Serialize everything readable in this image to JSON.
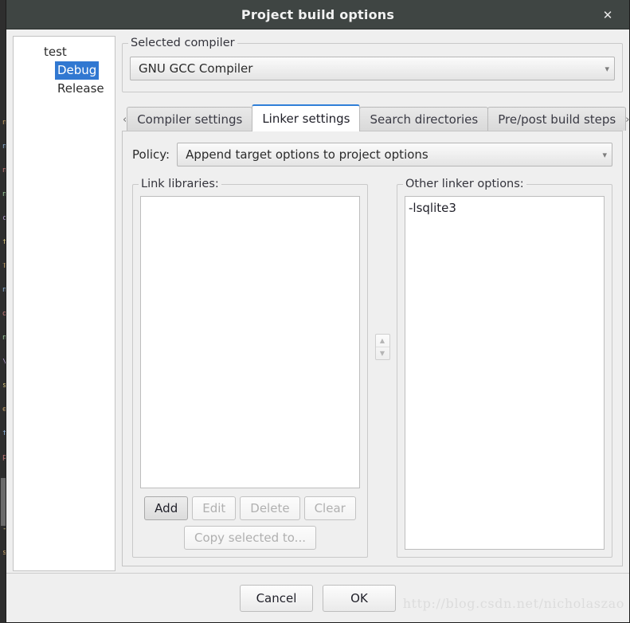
{
  "window": {
    "title": "Project build options",
    "close_label": "✕"
  },
  "tree": {
    "root": "test",
    "children": [
      {
        "label": "Debug",
        "selected": true
      },
      {
        "label": "Release",
        "selected": false
      }
    ]
  },
  "compiler": {
    "group_label": "Selected compiler",
    "selected": "GNU GCC Compiler",
    "arrow": "▾"
  },
  "tabs": {
    "scroll_left": "‹",
    "scroll_right": "›",
    "items": [
      {
        "label": "Compiler settings",
        "active": false
      },
      {
        "label": "Linker settings",
        "active": true
      },
      {
        "label": "Search directories",
        "active": false
      },
      {
        "label": "Pre/post build steps",
        "active": false
      }
    ]
  },
  "policy": {
    "label": "Policy:",
    "value": "Append target options to project options",
    "arrow": "▾"
  },
  "link_libraries": {
    "group_label": "Link libraries:",
    "items": [],
    "buttons": [
      {
        "label": "Add",
        "enabled": true
      },
      {
        "label": "Edit",
        "enabled": false
      },
      {
        "label": "Delete",
        "enabled": false
      },
      {
        "label": "Clear",
        "enabled": false
      }
    ],
    "copy_button": {
      "label": "Copy selected to...",
      "enabled": false
    }
  },
  "spinner": {
    "up": "▲",
    "down": "▼"
  },
  "other_linker_options": {
    "group_label": "Other linker options:",
    "value": "-lsqlite3"
  },
  "footer": {
    "cancel_label": "Cancel",
    "ok_label": "OK"
  },
  "watermark": {
    "text": "http://blog.csdn.net/nicholaszao"
  },
  "colors": {
    "titlebar": "#3f4543",
    "selection": "#3178d1",
    "tab_accent": "#2f7fd8",
    "dialog_bg": "#efefef",
    "field_bg": "#ffffff"
  },
  "background_editor": {
    "lines": [
      "n",
      "n",
      "n",
      "n",
      "c",
      "f",
      "T",
      "n",
      "o",
      "n",
      "\\",
      "s",
      "e",
      "f",
      "p",
      "r",
      "e",
      "-",
      "s"
    ]
  }
}
